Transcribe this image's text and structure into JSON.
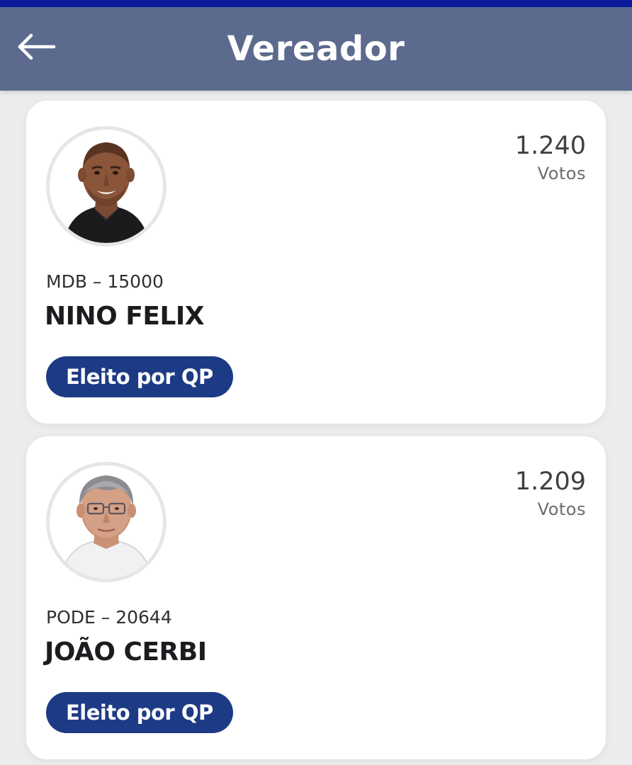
{
  "header": {
    "title": "Vereador",
    "back_icon": "arrow-left-icon"
  },
  "colors": {
    "accent_bar": "#0d1a9e",
    "header_bg": "#5c6a8e",
    "badge_bg": "#1d3a85",
    "page_bg": "#ececee"
  },
  "candidates": [
    {
      "votes": "1.240",
      "votes_label": "Votos",
      "party_number": "MDB – 15000",
      "name": "NINO FELIX",
      "status": "Eleito por QP",
      "photo": "candidate-photo"
    },
    {
      "votes": "1.209",
      "votes_label": "Votos",
      "party_number": "PODE – 20644",
      "name": "JOÃO CERBI",
      "status": "Eleito por QP",
      "photo": "candidate-photo"
    }
  ]
}
